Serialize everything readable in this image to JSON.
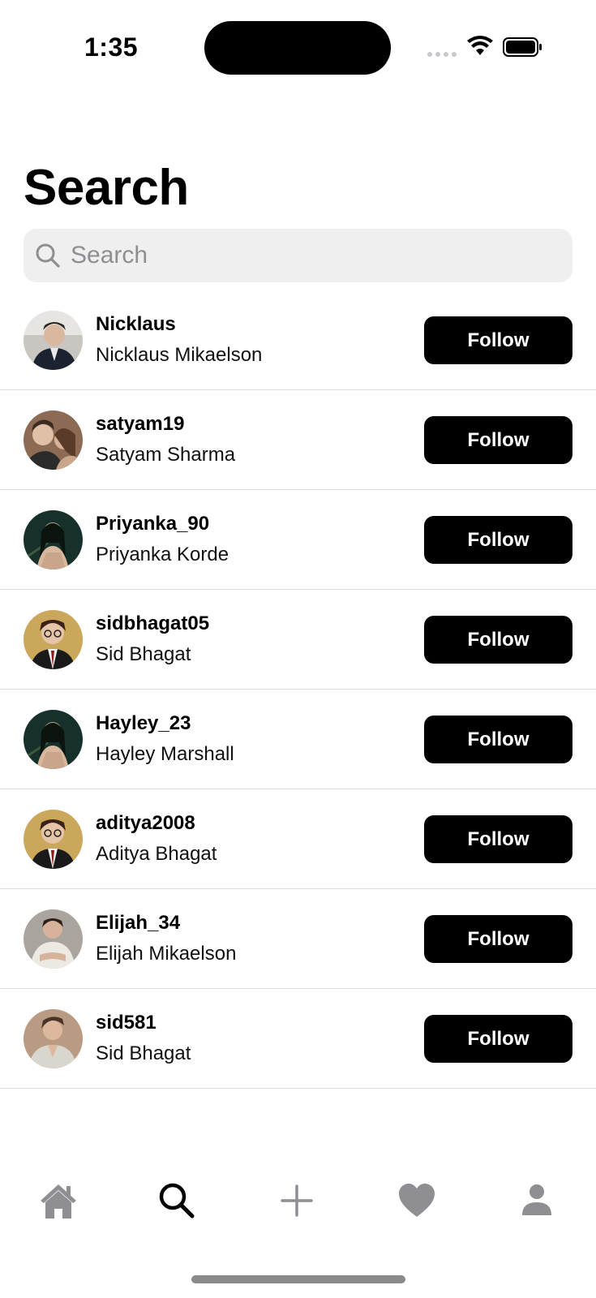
{
  "status_bar": {
    "time": "1:35"
  },
  "header": {
    "title": "Search"
  },
  "search": {
    "placeholder": "Search"
  },
  "users": [
    {
      "username": "Nicklaus",
      "fullname": "Nicklaus Mikaelson",
      "follow_label": "Follow"
    },
    {
      "username": "satyam19",
      "fullname": "Satyam Sharma",
      "follow_label": "Follow"
    },
    {
      "username": "Priyanka_90",
      "fullname": "Priyanka Korde",
      "follow_label": "Follow"
    },
    {
      "username": "sidbhagat05",
      "fullname": "Sid Bhagat",
      "follow_label": "Follow"
    },
    {
      "username": "Hayley_23",
      "fullname": "Hayley Marshall",
      "follow_label": "Follow"
    },
    {
      "username": "aditya2008",
      "fullname": "Aditya Bhagat",
      "follow_label": "Follow"
    },
    {
      "username": "Elijah_34",
      "fullname": "Elijah Mikaelson",
      "follow_label": "Follow"
    },
    {
      "username": "sid581",
      "fullname": "Sid Bhagat",
      "follow_label": "Follow"
    }
  ],
  "tab_bar": {
    "items": [
      {
        "icon": "home-icon",
        "active": false
      },
      {
        "icon": "search-icon",
        "active": true
      },
      {
        "icon": "plus-icon",
        "active": false
      },
      {
        "icon": "heart-icon",
        "active": false
      },
      {
        "icon": "person-icon",
        "active": false
      }
    ]
  },
  "colors": {
    "accent": "#000000",
    "inactive_tab": "#8e8e93",
    "search_bg": "#efefef"
  }
}
